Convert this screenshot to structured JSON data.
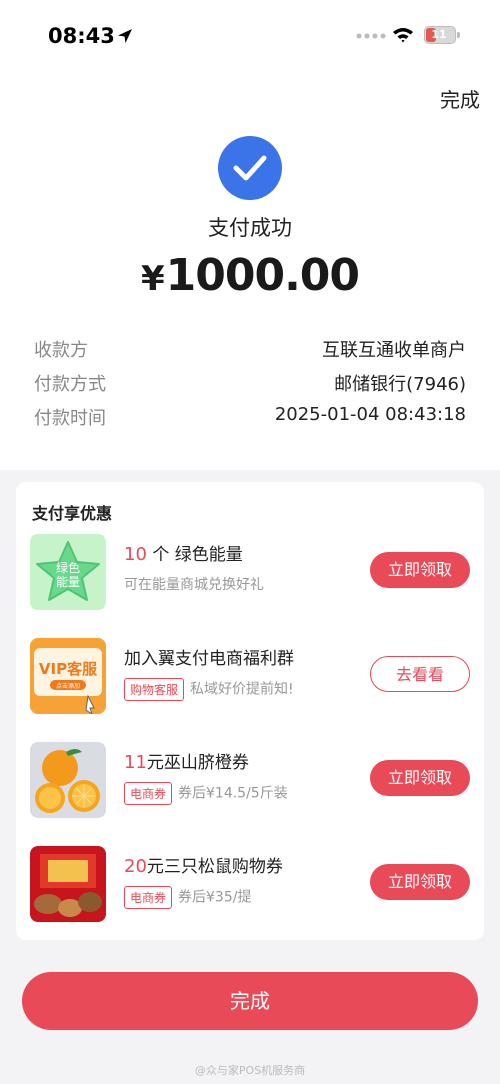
{
  "status_bar": {
    "time": "08:43",
    "battery": "11"
  },
  "header": {
    "done_label": "完成"
  },
  "result": {
    "title": "支付成功",
    "currency": "¥",
    "amount": "1000.00"
  },
  "details": [
    {
      "label": "收款方",
      "value": "互联互通收单商户"
    },
    {
      "label": "付款方式",
      "value": "邮储银行(7946)"
    },
    {
      "label": "付款时间",
      "value": "2025-01-04 08:43:18"
    }
  ],
  "promo": {
    "title": "支付享优惠",
    "items": [
      {
        "num": "10",
        "name": "个 绿色能量",
        "sub": "可在能量商城兑换好礼",
        "tag": "",
        "button": "立即领取",
        "img_text": "绿色能量"
      },
      {
        "num": "",
        "name": "加入翼支付电商福利群",
        "sub": "私域好价提前知!",
        "tag": "购物客服",
        "button": "去看看",
        "img_text": "VIP客服",
        "img_sub": "点击添加"
      },
      {
        "num": "11",
        "name": "元巫山脐橙券",
        "sub": "券后¥14.5/5斤装",
        "tag": "电商券",
        "button": "立即领取"
      },
      {
        "num": "20",
        "name": "元三只松鼠购物券",
        "sub": "券后¥35/提",
        "tag": "电商券",
        "button": "立即领取"
      }
    ]
  },
  "footer": {
    "done_label": "完成",
    "watermark": "@众与家POS机服务商"
  },
  "colors": {
    "accent": "#e94a58",
    "success": "#3b73e8"
  }
}
